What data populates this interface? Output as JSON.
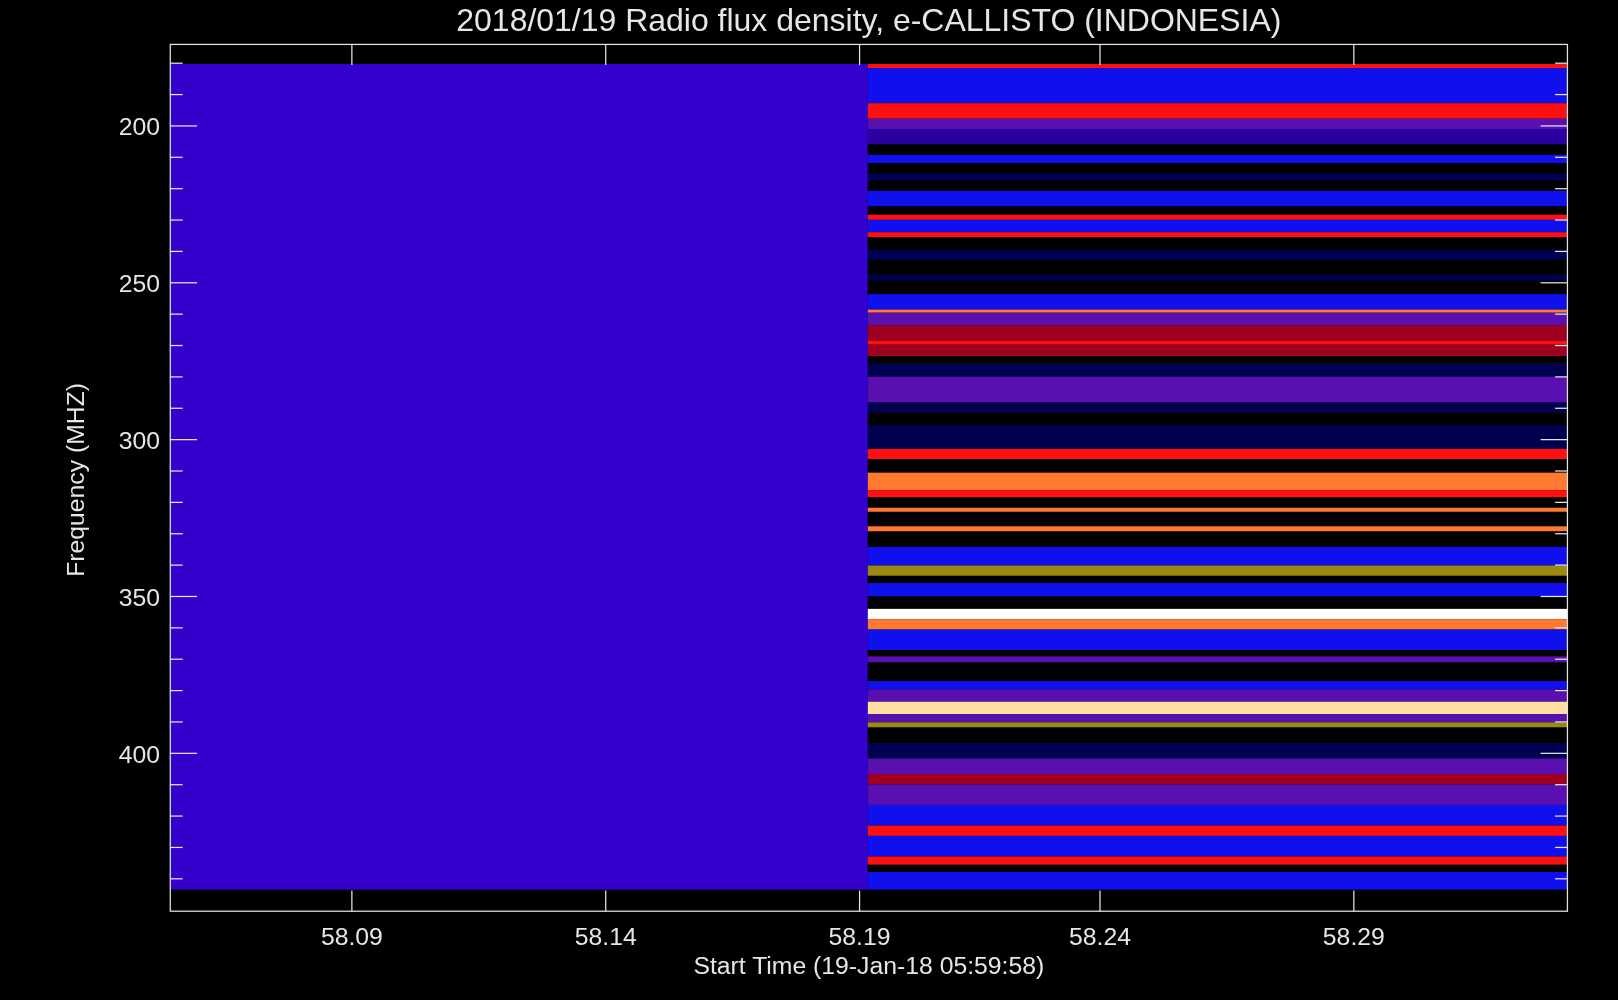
{
  "title": "2018/01/19  Radio flux density, e-CALLISTO (INDONESIA)",
  "y_axis": {
    "label": "Frequency (MHZ)",
    "tick_labels": [
      "200",
      "250",
      "300",
      "350",
      "400"
    ]
  },
  "x_axis": {
    "label": "Start Time (19-Jan-18 05:59:58)",
    "tick_labels": [
      "58.09",
      "58.14",
      "58.19",
      "58.24",
      "58.29"
    ]
  }
}
